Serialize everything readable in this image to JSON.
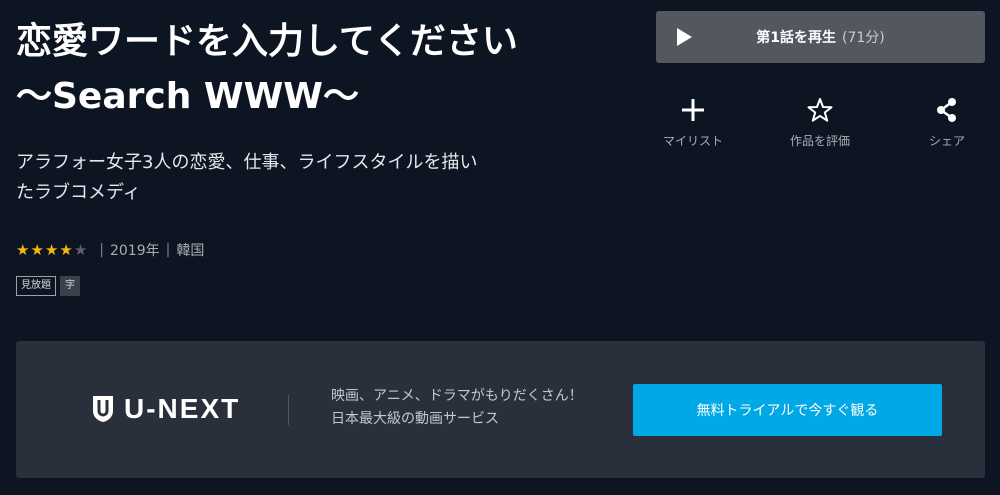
{
  "title": {
    "line1": "恋愛ワードを入力してください",
    "line2": "〜Search WWW〜"
  },
  "description": {
    "line1": "アラフォー女子3人の恋愛、仕事、ライフスタイルを描い",
    "line2": "たラブコメディ"
  },
  "rating": {
    "value": 4,
    "max": 5
  },
  "meta": {
    "year": "2019年",
    "country": "韓国",
    "separator": "|"
  },
  "badges": [
    "見放題",
    "字"
  ],
  "play": {
    "label": "第1話を再生",
    "duration": "(71分)",
    "icon": "play-icon"
  },
  "actions": [
    {
      "label": "マイリスト",
      "icon": "plus-icon"
    },
    {
      "label": "作品を評価",
      "icon": "star-outline-icon"
    },
    {
      "label": "シェア",
      "icon": "share-icon"
    }
  ],
  "banner": {
    "logo_text": "U-NEXT",
    "logo_icon": "u-next-shield-icon",
    "tagline_line1": "映画、アニメ、ドラマがもりだくさん！",
    "tagline_line2": "日本最大級の動画サービス",
    "cta": "無料トライアルで今すぐ観る"
  },
  "colors": {
    "background": "#0e1522",
    "play_button": "#525760",
    "star_on": "#f5b80b",
    "star_off": "#5b606a",
    "banner_bg": "#2a303b",
    "cta_bg": "#00a8e6"
  }
}
